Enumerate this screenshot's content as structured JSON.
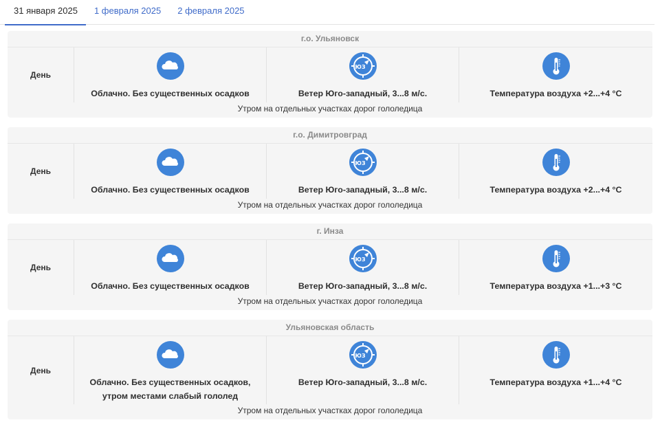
{
  "tabs": [
    {
      "label": "31 января 2025"
    },
    {
      "label": "1 февраля 2025"
    },
    {
      "label": "2 февраля 2025"
    }
  ],
  "colors": {
    "accent": "#3f6bc9",
    "icon_bg": "#3f84d8",
    "card_bg": "#f5f5f5"
  },
  "icons": {
    "cloud": "cloud-icon",
    "wind": "wind-compass-icon",
    "temperature": "thermometer-icon"
  },
  "forecasts": [
    {
      "area": "г.о. Ульяновск",
      "period": "День",
      "cloud": "Облачно. Без существенных осадков",
      "wind": "Ветер Юго-западный, 3...8 м/с.",
      "wind_dir": "ЮЗ",
      "temperature": "Температура воздуха +2...+4 °C",
      "note": "Утром на отдельных участках дорог гололедица"
    },
    {
      "area": "г.о. Димитровград",
      "period": "День",
      "cloud": "Облачно. Без существенных осадков",
      "wind": "Ветер Юго-западный, 3...8 м/с.",
      "wind_dir": "ЮЗ",
      "temperature": "Температура воздуха +2...+4 °C",
      "note": "Утром на отдельных участках дорог гололедица"
    },
    {
      "area": "г. Инза",
      "period": "День",
      "cloud": "Облачно. Без существенных осадков",
      "wind": "Ветер Юго-западный, 3...8 м/с.",
      "wind_dir": "ЮЗ",
      "temperature": "Температура воздуха +1...+3 °C",
      "note": "Утром на отдельных участках дорог гололедица"
    },
    {
      "area": "Ульяновская область",
      "period": "День",
      "cloud": "Облачно. Без существенных осадков, утром местами слабый гололед",
      "wind": "Ветер Юго-западный, 3...8 м/с.",
      "wind_dir": "ЮЗ",
      "temperature": "Температура воздуха +1...+4 °C",
      "note": "Утром на отдельных участках дорог гололедица"
    }
  ]
}
